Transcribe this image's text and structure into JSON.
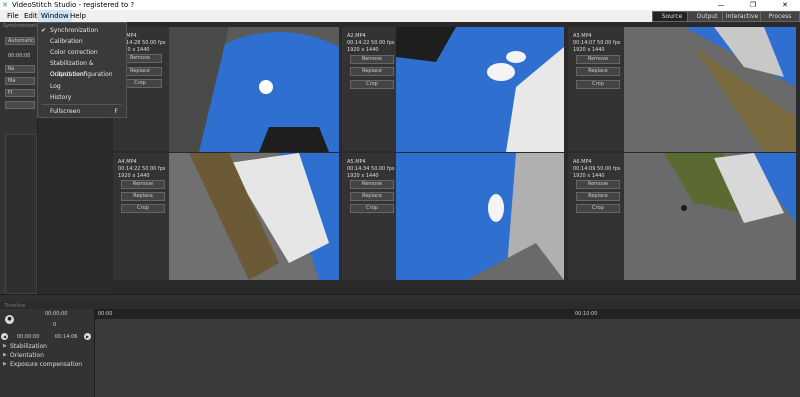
{
  "window": {
    "title": "VideoStitch Studio - registered to ?",
    "minimize": "—",
    "maximize": "❐",
    "close": "✕"
  },
  "menu": [
    "File",
    "Edit",
    "Window",
    "Help"
  ],
  "top_buttons": [
    "Source",
    "Output",
    "Interactive",
    "Process"
  ],
  "dropdown": [
    {
      "label": "Synchronization",
      "checked": true,
      "key": ""
    },
    {
      "label": "Calibration",
      "checked": false,
      "key": ""
    },
    {
      "label": "Color correction",
      "checked": false,
      "key": ""
    },
    {
      "label": "Stabilization & Orientation",
      "checked": false,
      "key": ""
    },
    {
      "label": "Output configuration",
      "checked": false,
      "key": ""
    },
    {
      "label": "Log",
      "checked": false,
      "key": ""
    },
    {
      "label": "History",
      "checked": false,
      "key": ""
    },
    {
      "label": "Fullscreen",
      "checked": false,
      "key": "F"
    }
  ],
  "left_panel": {
    "header": "Synchronization",
    "buttons": [
      "Automatic",
      "",
      "Re",
      "Ma",
      "Fl",
      ""
    ],
    "time": "00:00:00"
  },
  "sources": [
    {
      "name": "A1.MP4",
      "line1": "00:14:28 50.00 fps",
      "line2": "1920 x 1440"
    },
    {
      "name": "A2.MP4",
      "line1": "00:14:22 50.00 fps",
      "line2": "1920 x 1440"
    },
    {
      "name": "A3.MP4",
      "line1": "00:14:07 50.00 fps",
      "line2": "1920 x 1440"
    },
    {
      "name": "A4.MP4",
      "line1": "00:14:22 50.00 fps",
      "line2": "1920 x 1440"
    },
    {
      "name": "A5.MP4",
      "line1": "00:14:34 50.00 fps",
      "line2": "1920 x 1440"
    },
    {
      "name": "A6.MP4",
      "line1": "00:14:09 50.00 fps",
      "line2": "1920 x 1440"
    }
  ],
  "card_buttons": [
    "Remove",
    "Replace",
    "Crop"
  ],
  "timeline": {
    "header": "Timeline",
    "play_time": "00:00:00",
    "frame": "0",
    "start": "00:00:00",
    "end": "00:14:06",
    "ruler_start": "00:00",
    "ruler_mid": "00:10:00",
    "tracks": [
      "Stabilization",
      "Orientation",
      "Exposure compensation"
    ]
  },
  "colors": {
    "sky": "#2f6fd0",
    "ground": "#6a6a6a",
    "accent": "#cfe3f7"
  }
}
